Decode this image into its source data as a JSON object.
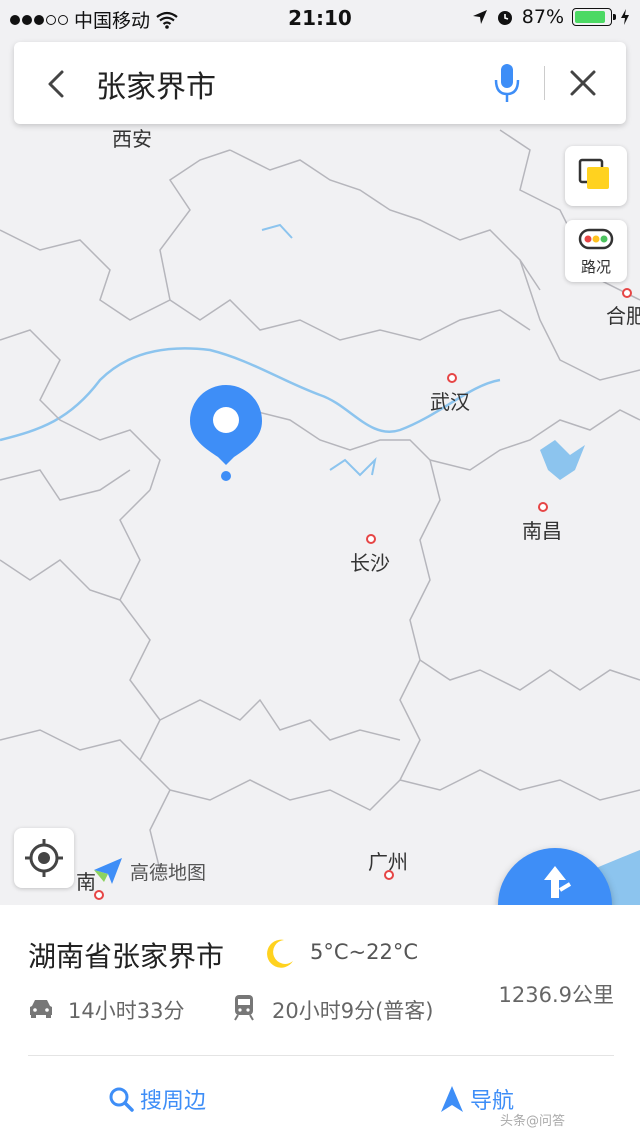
{
  "status": {
    "carrier": "中国移动",
    "time": "21:10",
    "battery_pct": "87%",
    "battery_level": 0.87
  },
  "search": {
    "query": "张家界市"
  },
  "map": {
    "cities": [
      {
        "name": "西安",
        "has_dot": false
      },
      {
        "name": "武汉",
        "has_dot": true
      },
      {
        "name": "合肥",
        "has_dot": true
      },
      {
        "name": "南昌",
        "has_dot": true
      },
      {
        "name": "长沙",
        "has_dot": true
      },
      {
        "name": "广州",
        "has_dot": true
      },
      {
        "name": "南",
        "has_dot": true
      }
    ],
    "controls": {
      "traffic_label": "路况"
    },
    "brand": "高德地图",
    "route_label": "路线"
  },
  "place": {
    "name": "湖南省张家界市",
    "weather_icon": "moon-icon",
    "temperature": "5°C~22°C",
    "distance": "1236.9公里",
    "drive_time": "14小时33分",
    "train_time": "20小时9分(普客)"
  },
  "actions": {
    "nearby": "搜周边",
    "navigate": "导航"
  },
  "watermark": "头条@问答",
  "colors": {
    "accent": "#3e8ef7",
    "city_dot": "#e64545",
    "water": "#8cc4ee"
  }
}
